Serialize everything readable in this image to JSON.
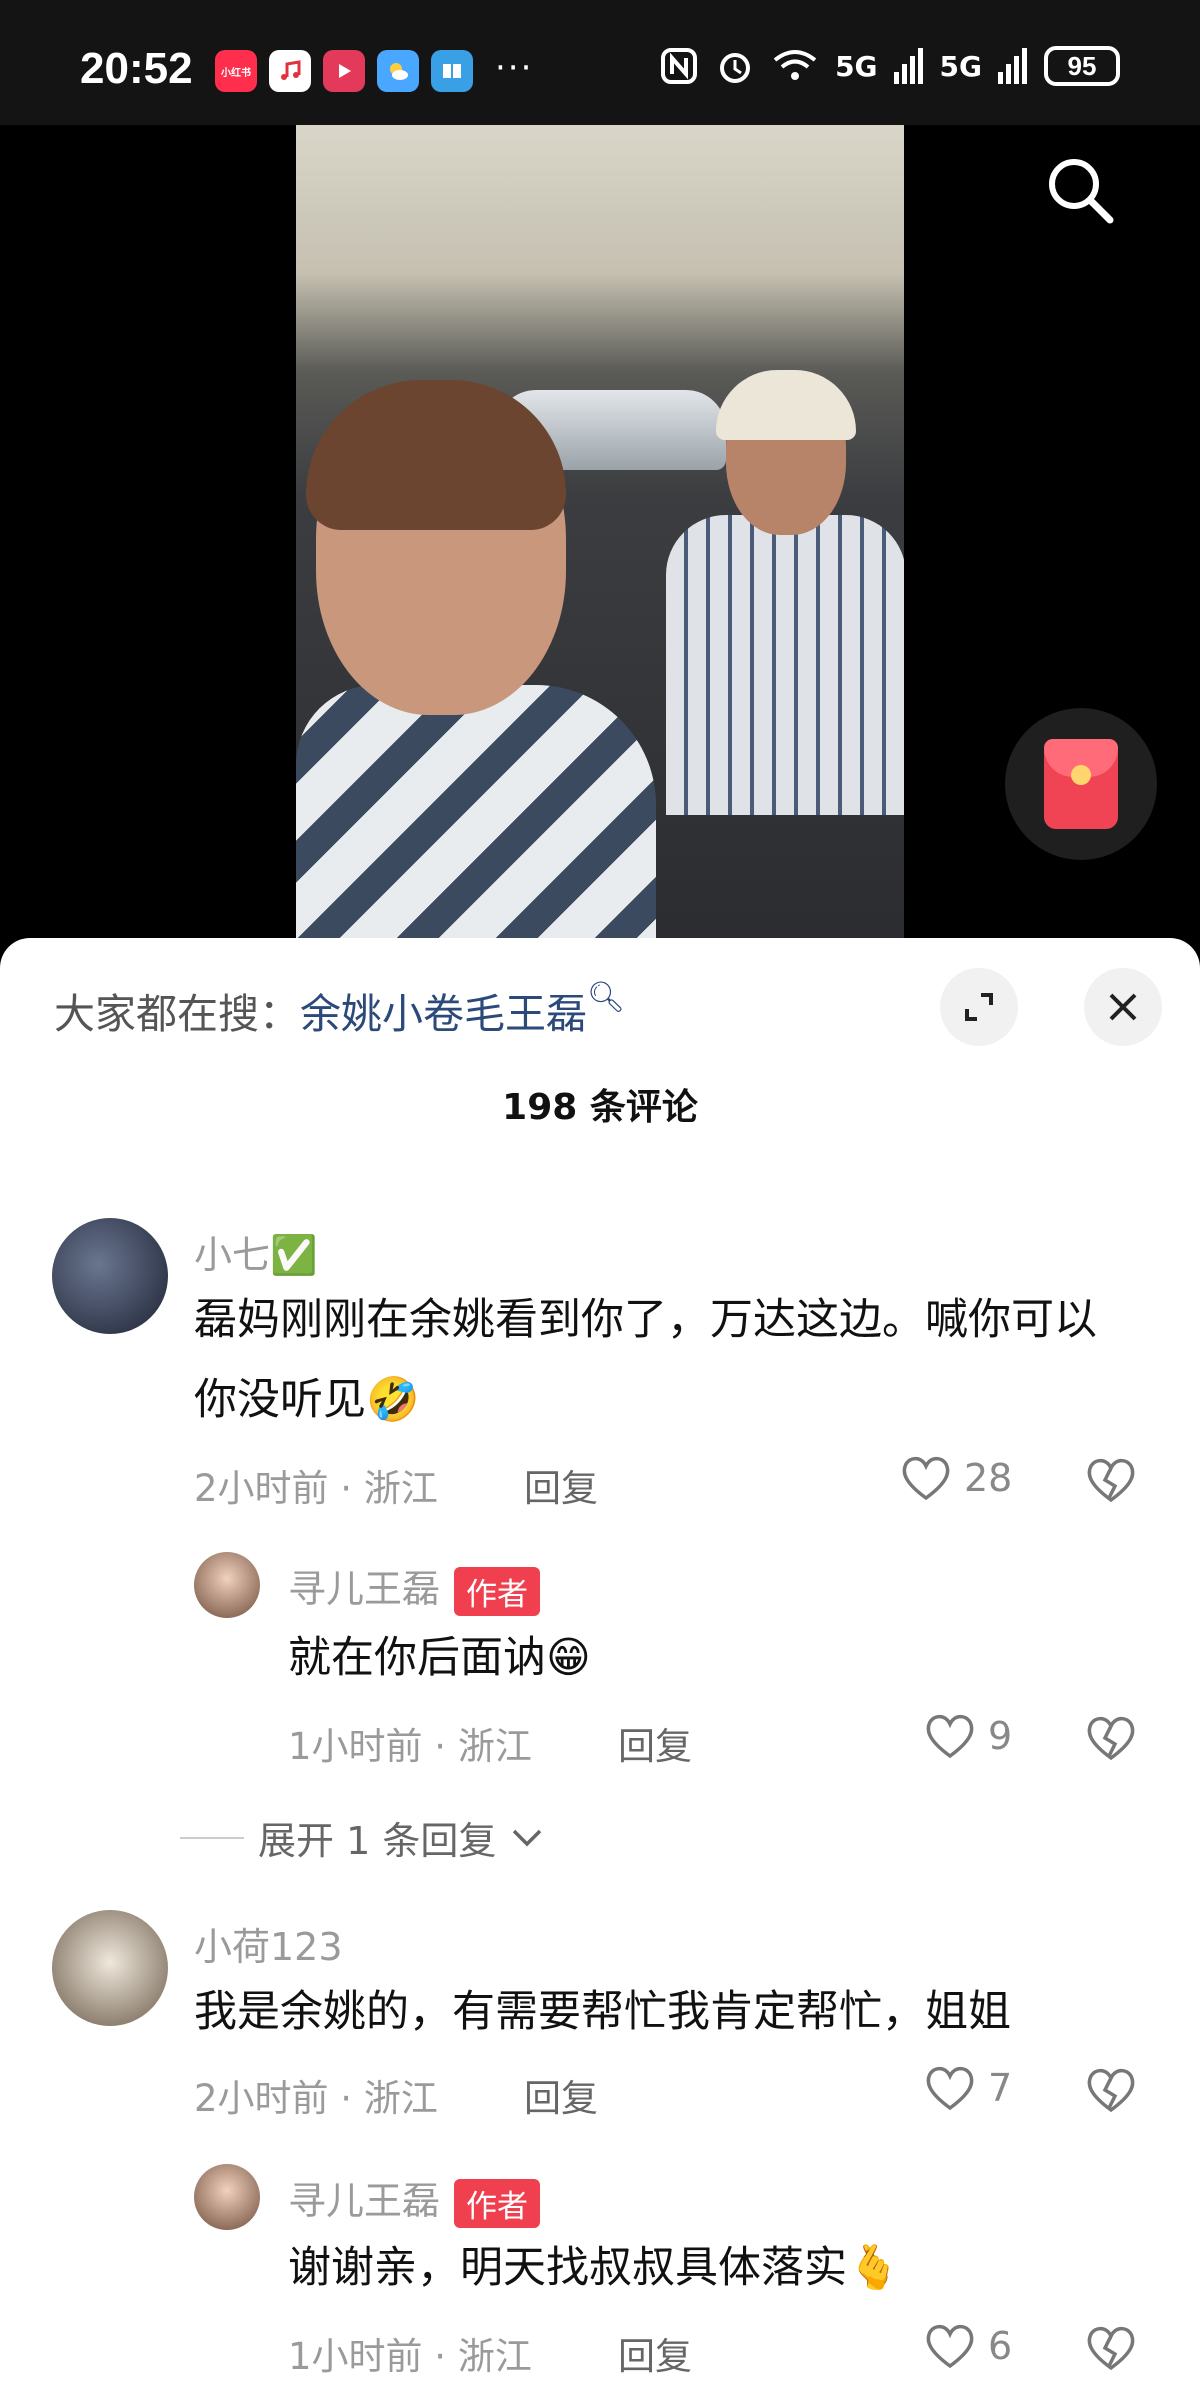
{
  "status_bar": {
    "time": "20:52",
    "battery": "95",
    "network_1": "5G",
    "network_2": "5G",
    "more_dots": "···"
  },
  "app_icons": [
    "xiaohongshu-icon",
    "music-icon",
    "video-icon",
    "weather-icon",
    "book-icon"
  ],
  "app_icon_labels": {
    "xhs": "小红书"
  },
  "panel": {
    "search_label": "大家都在搜：",
    "search_term": "余姚小卷毛王磊",
    "comment_count": "198 条评论"
  },
  "comments": [
    {
      "user": "小七✅",
      "text": "磊妈刚刚在余姚看到你了，万达这边。喊你可以你没听见🤣",
      "time_location": "2小时前 · 浙江",
      "reply_label": "回复",
      "likes": "28",
      "replies": [
        {
          "user": "寻儿王磊",
          "badge": "作者",
          "text": "就在你后面讷😁",
          "time_location": "1小时前 · 浙江",
          "reply_label": "回复",
          "likes": "9"
        }
      ],
      "expand_label": "展开 1 条回复"
    },
    {
      "user": "小荷123",
      "text": "我是余姚的，有需要帮忙我肯定帮忙，姐姐",
      "time_location": "2小时前 · 浙江",
      "reply_label": "回复",
      "likes": "7",
      "replies": [
        {
          "user": "寻儿王磊",
          "badge": "作者",
          "text": "谢谢亲，明天找叔叔具体落实🫰",
          "time_location": "1小时前 · 浙江",
          "reply_label": "回复",
          "likes": "6"
        }
      ]
    }
  ],
  "colors": {
    "accent_red": "#f0404f",
    "search_term_blue": "#2b4a7a"
  }
}
